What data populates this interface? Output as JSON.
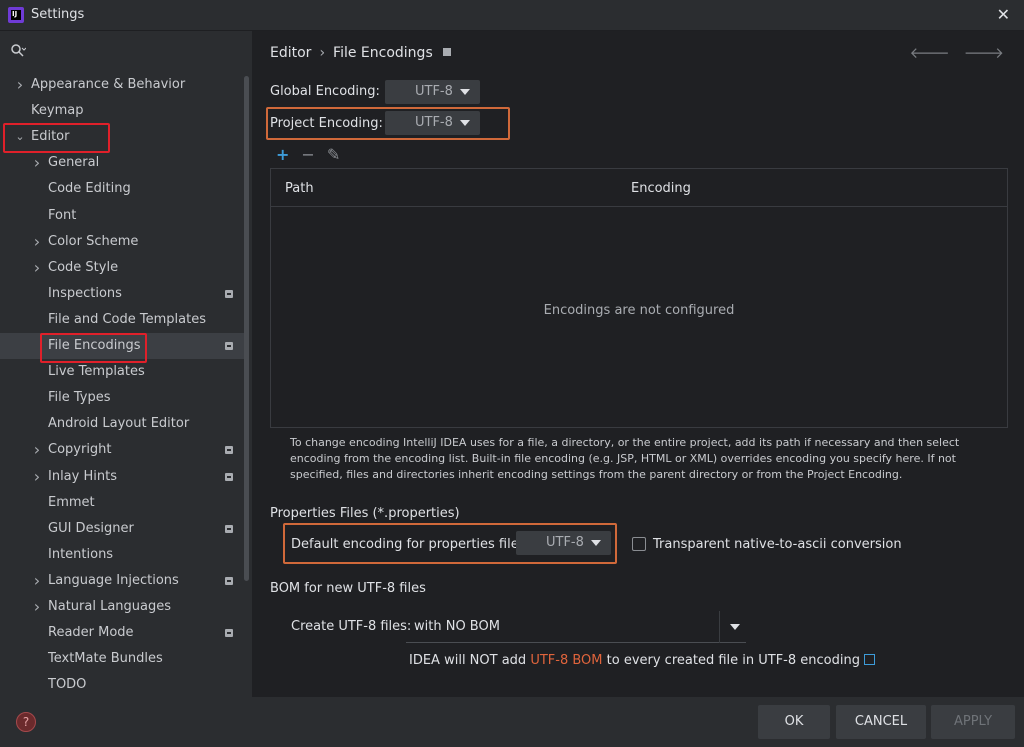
{
  "window": {
    "title": "Settings",
    "close_icon": "close-icon",
    "app_icon": "intellij-icon",
    "app_icon_text": "IJ"
  },
  "sidebar": {
    "search_placeholder": "",
    "items": [
      {
        "label": "Appearance & Behavior",
        "expandable": true,
        "expanded": false
      },
      {
        "label": "Keymap",
        "expandable": false
      },
      {
        "label": "Editor",
        "expandable": true,
        "expanded": true
      },
      {
        "label": "General",
        "expandable": true,
        "expanded": false
      },
      {
        "label": "Code Editing",
        "expandable": false
      },
      {
        "label": "Font",
        "expandable": false
      },
      {
        "label": "Color Scheme",
        "expandable": true,
        "expanded": false
      },
      {
        "label": "Code Style",
        "expandable": true,
        "expanded": false
      },
      {
        "label": "Inspections",
        "expandable": false,
        "badge": true
      },
      {
        "label": "File and Code Templates",
        "expandable": false
      },
      {
        "label": "File Encodings",
        "expandable": false,
        "badge": true,
        "selected": true
      },
      {
        "label": "Live Templates",
        "expandable": false
      },
      {
        "label": "File Types",
        "expandable": false
      },
      {
        "label": "Android Layout Editor",
        "expandable": false
      },
      {
        "label": "Copyright",
        "expandable": true,
        "badge": true
      },
      {
        "label": "Inlay Hints",
        "expandable": true,
        "badge": true
      },
      {
        "label": "Emmet",
        "expandable": false
      },
      {
        "label": "GUI Designer",
        "expandable": false,
        "badge": true
      },
      {
        "label": "Intentions",
        "expandable": false
      },
      {
        "label": "Language Injections",
        "expandable": true,
        "badge": true
      },
      {
        "label": "Natural Languages",
        "expandable": true
      },
      {
        "label": "Reader Mode",
        "expandable": false,
        "badge": true
      },
      {
        "label": "TextMate Bundles",
        "expandable": false
      },
      {
        "label": "TODO",
        "expandable": false
      }
    ]
  },
  "breadcrumb": {
    "parent": "Editor",
    "separator": "›",
    "current": "File Encodings",
    "back_icon": "arrow-left-icon",
    "forward_icon": "arrow-right-icon"
  },
  "encodings": {
    "global_label": "Global Encoding:",
    "global_value": "UTF-8",
    "project_label": "Project Encoding:",
    "project_value": "UTF-8"
  },
  "table": {
    "toolbar": {
      "add": "+",
      "remove": "−",
      "edit": "✎"
    },
    "columns": [
      "Path",
      "Encoding"
    ],
    "empty_text": "Encodings are not configured"
  },
  "help_text": "To change encoding IntelliJ IDEA uses for a file, a directory, or the entire project, add its path if necessary and then select encoding from the encoding list. Built-in file encoding (e.g. JSP, HTML or XML) overrides encoding you specify here. If not specified, files and directories inherit encoding settings from the parent directory or from the Project Encoding.",
  "properties": {
    "section_title": "Properties Files (*.properties)",
    "default_label": "Default encoding for properties files:",
    "default_value": "UTF-8",
    "transparent_label": "Transparent native-to-ascii conversion",
    "transparent_checked": false
  },
  "bom": {
    "section_title": "BOM for new UTF-8 files",
    "create_label": "Create UTF-8 files:",
    "create_value": "with NO BOM",
    "note_prefix": "IDEA will NOT add ",
    "note_highlight": "UTF-8 BOM",
    "note_suffix": " to every created file in UTF-8 encoding"
  },
  "footer": {
    "help": "?",
    "ok": "OK",
    "cancel": "CANCEL",
    "apply": "APPLY"
  },
  "colors": {
    "accent_red_box": "#e0202a",
    "accent_orange_box": "#d0693a",
    "highlight": "#e0643c",
    "link": "#3d9cd9"
  }
}
